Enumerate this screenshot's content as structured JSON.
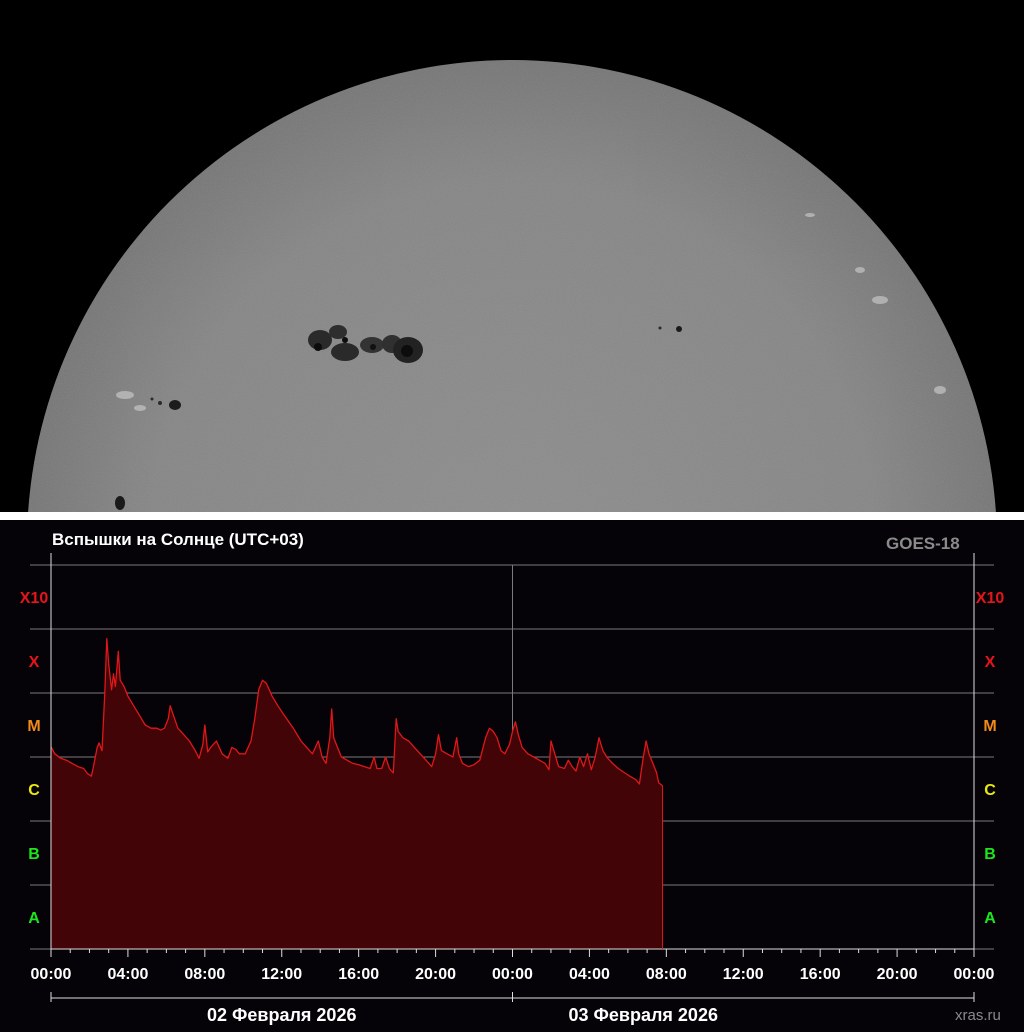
{
  "chart_title": "Вспышки на Солнце (UTC+03)",
  "satellite": "GOES-18",
  "watermark": "xras.ru",
  "colors": {
    "background": "#050308",
    "flux_line": "#e0161a",
    "flux_fill": "#420406",
    "grid": "#7a7a7a",
    "class_X": "#e8141c",
    "class_M": "#f08a18",
    "class_C": "#e8e816",
    "class_B": "#1ee61e",
    "class_A": "#1ee61e"
  },
  "sun_image": {
    "description_icon": "sun-photosphere-image",
    "sunspot_groups": 4
  },
  "chart_data": {
    "type": "area",
    "title": "Вспышки на Солнце (UTC+03)",
    "x_unit": "hours since 02 Февраля 2026 00:00 (UTC+03)",
    "x_range": [
      0,
      48
    ],
    "y_scale": "log-class",
    "y_classes": [
      "A",
      "B",
      "C",
      "M",
      "X",
      "X10"
    ],
    "y_class_colors": [
      "#1ee61e",
      "#1ee61e",
      "#e8e816",
      "#f08a18",
      "#e8141c",
      "#e8141c"
    ],
    "y_range": [
      0,
      6
    ],
    "x_tick_labels": [
      "00:00",
      "04:00",
      "08:00",
      "12:00",
      "16:00",
      "20:00",
      "00:00",
      "04:00",
      "08:00",
      "12:00",
      "16:00",
      "20:00",
      "00:00"
    ],
    "date_labels": [
      "02 Февраля 2026",
      "03 Февраля 2026"
    ],
    "series": [
      {
        "name": "GOES-18",
        "points": [
          [
            0.0,
            3.16
          ],
          [
            0.2,
            3.05
          ],
          [
            0.5,
            2.98
          ],
          [
            0.8,
            2.95
          ],
          [
            1.1,
            2.9
          ],
          [
            1.4,
            2.85
          ],
          [
            1.7,
            2.82
          ],
          [
            1.9,
            2.74
          ],
          [
            2.1,
            2.7
          ],
          [
            2.2,
            2.84
          ],
          [
            2.4,
            3.15
          ],
          [
            2.5,
            3.22
          ],
          [
            2.65,
            3.1
          ],
          [
            2.8,
            4.0
          ],
          [
            2.9,
            4.85
          ],
          [
            3.0,
            4.45
          ],
          [
            3.15,
            4.05
          ],
          [
            3.25,
            4.3
          ],
          [
            3.35,
            4.1
          ],
          [
            3.5,
            4.65
          ],
          [
            3.6,
            4.2
          ],
          [
            3.8,
            4.1
          ],
          [
            4.0,
            3.95
          ],
          [
            4.3,
            3.8
          ],
          [
            4.6,
            3.65
          ],
          [
            4.9,
            3.5
          ],
          [
            5.2,
            3.45
          ],
          [
            5.5,
            3.45
          ],
          [
            5.7,
            3.42
          ],
          [
            5.9,
            3.45
          ],
          [
            6.1,
            3.6
          ],
          [
            6.2,
            3.8
          ],
          [
            6.4,
            3.62
          ],
          [
            6.6,
            3.45
          ],
          [
            6.9,
            3.35
          ],
          [
            7.2,
            3.25
          ],
          [
            7.5,
            3.1
          ],
          [
            7.7,
            2.98
          ],
          [
            7.9,
            3.2
          ],
          [
            8.0,
            3.5
          ],
          [
            8.15,
            3.08
          ],
          [
            8.3,
            3.15
          ],
          [
            8.6,
            3.25
          ],
          [
            8.9,
            3.05
          ],
          [
            9.2,
            2.98
          ],
          [
            9.4,
            3.15
          ],
          [
            9.6,
            3.12
          ],
          [
            9.8,
            3.05
          ],
          [
            10.1,
            3.05
          ],
          [
            10.4,
            3.25
          ],
          [
            10.6,
            3.6
          ],
          [
            10.8,
            4.05
          ],
          [
            11.0,
            4.2
          ],
          [
            11.2,
            4.15
          ],
          [
            11.5,
            3.95
          ],
          [
            11.8,
            3.8
          ],
          [
            12.2,
            3.62
          ],
          [
            12.6,
            3.45
          ],
          [
            13.0,
            3.25
          ],
          [
            13.3,
            3.15
          ],
          [
            13.6,
            3.05
          ],
          [
            13.9,
            3.25
          ],
          [
            14.1,
            3.0
          ],
          [
            14.3,
            2.9
          ],
          [
            14.5,
            3.3
          ],
          [
            14.6,
            3.75
          ],
          [
            14.7,
            3.3
          ],
          [
            14.9,
            3.15
          ],
          [
            15.1,
            3.0
          ],
          [
            15.4,
            2.95
          ],
          [
            15.7,
            2.9
          ],
          [
            16.0,
            2.88
          ],
          [
            16.3,
            2.85
          ],
          [
            16.6,
            2.82
          ],
          [
            16.8,
            3.0
          ],
          [
            16.95,
            2.82
          ],
          [
            17.2,
            2.82
          ],
          [
            17.4,
            3.0
          ],
          [
            17.6,
            2.82
          ],
          [
            17.8,
            2.75
          ],
          [
            17.95,
            3.6
          ],
          [
            18.05,
            3.4
          ],
          [
            18.3,
            3.3
          ],
          [
            18.6,
            3.25
          ],
          [
            18.9,
            3.15
          ],
          [
            19.2,
            3.05
          ],
          [
            19.5,
            2.95
          ],
          [
            19.8,
            2.85
          ],
          [
            20.0,
            3.05
          ],
          [
            20.15,
            3.35
          ],
          [
            20.3,
            3.1
          ],
          [
            20.6,
            3.05
          ],
          [
            20.9,
            3.0
          ],
          [
            21.1,
            3.3
          ],
          [
            21.2,
            3.05
          ],
          [
            21.4,
            2.9
          ],
          [
            21.7,
            2.85
          ],
          [
            22.0,
            2.88
          ],
          [
            22.3,
            2.95
          ],
          [
            22.6,
            3.3
          ],
          [
            22.8,
            3.45
          ],
          [
            23.0,
            3.4
          ],
          [
            23.2,
            3.3
          ],
          [
            23.4,
            3.1
          ],
          [
            23.6,
            3.05
          ],
          [
            23.85,
            3.2
          ],
          [
            24.0,
            3.4
          ],
          [
            24.15,
            3.55
          ],
          [
            24.3,
            3.35
          ],
          [
            24.5,
            3.15
          ],
          [
            24.8,
            3.05
          ],
          [
            25.1,
            3.0
          ],
          [
            25.4,
            2.95
          ],
          [
            25.7,
            2.9
          ],
          [
            25.9,
            2.8
          ],
          [
            26.0,
            3.25
          ],
          [
            26.15,
            3.1
          ],
          [
            26.4,
            2.85
          ],
          [
            26.7,
            2.82
          ],
          [
            26.9,
            2.95
          ],
          [
            27.1,
            2.85
          ],
          [
            27.3,
            2.78
          ],
          [
            27.5,
            3.0
          ],
          [
            27.7,
            2.85
          ],
          [
            27.9,
            3.05
          ],
          [
            28.1,
            2.8
          ],
          [
            28.3,
            3.0
          ],
          [
            28.5,
            3.3
          ],
          [
            28.7,
            3.1
          ],
          [
            28.9,
            3.0
          ],
          [
            29.2,
            2.9
          ],
          [
            29.5,
            2.82
          ],
          [
            29.8,
            2.76
          ],
          [
            30.1,
            2.7
          ],
          [
            30.4,
            2.65
          ],
          [
            30.6,
            2.58
          ],
          [
            30.8,
            3.0
          ],
          [
            30.95,
            3.25
          ],
          [
            31.1,
            3.05
          ],
          [
            31.3,
            2.9
          ],
          [
            31.5,
            2.75
          ],
          [
            31.6,
            2.6
          ],
          [
            31.8,
            2.55
          ]
        ]
      }
    ],
    "grid": true,
    "legend": "none"
  }
}
